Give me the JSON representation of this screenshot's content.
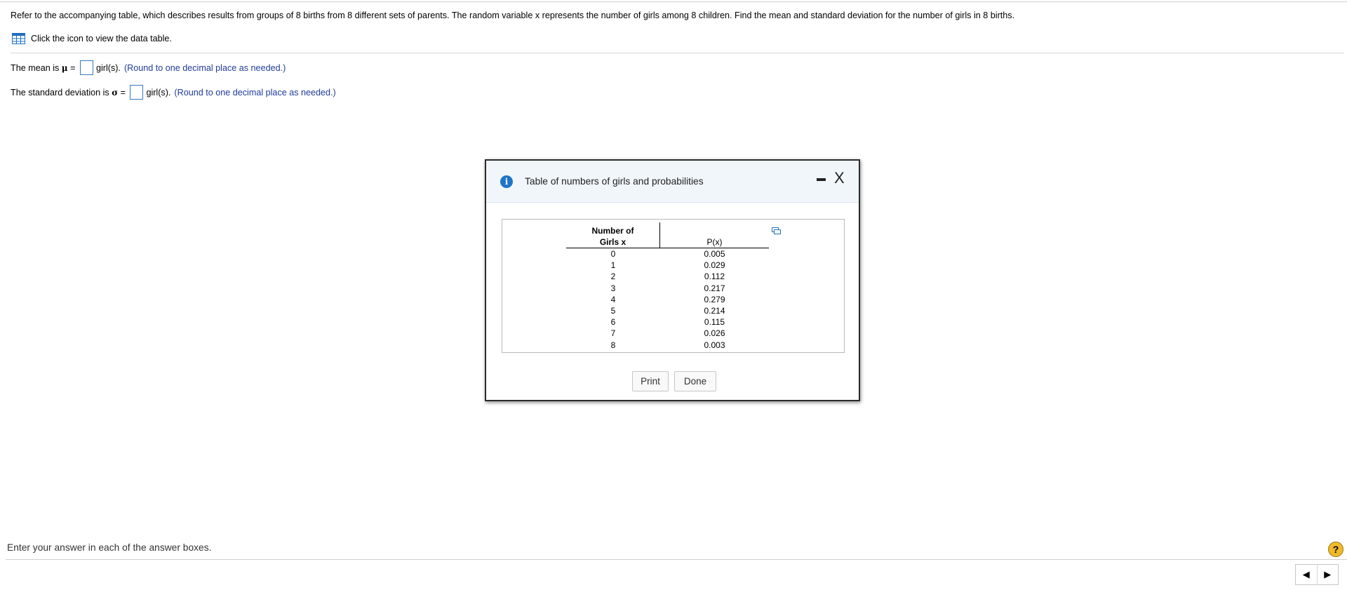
{
  "question": {
    "text": "Refer to the accompanying table, which describes results from groups of 8 births from 8 different sets of parents. The random variable x represents the number of girls among 8 children. Find the mean and standard deviation for the number of girls in 8 births."
  },
  "table_link": {
    "label": "Click the icon to view the data table."
  },
  "answers": {
    "mean": {
      "prefix": "The mean is ",
      "symbol": "μ",
      "equals": " = ",
      "unit": "girl(s).",
      "hint": "(Round to one decimal place as needed.)",
      "value": ""
    },
    "sd": {
      "prefix": "The standard deviation is ",
      "symbol": "σ",
      "equals": " = ",
      "unit": "girl(s).",
      "hint": "(Round to one decimal place as needed.)",
      "value": ""
    }
  },
  "dialog": {
    "title": "Table of numbers of girls and probabilities",
    "info_icon_glyph": "i",
    "close_glyph": "X",
    "table": {
      "col_x_header": [
        "Number of",
        "Girls x"
      ],
      "col_p_header": "P(x)",
      "x": [
        "0",
        "1",
        "2",
        "3",
        "4",
        "5",
        "6",
        "7",
        "8"
      ],
      "p": [
        "0.005",
        "0.029",
        "0.112",
        "0.217",
        "0.279",
        "0.214",
        "0.115",
        "0.026",
        "0.003"
      ]
    },
    "buttons": {
      "print": "Print",
      "done": "Done"
    }
  },
  "footer": {
    "instruction": "Enter your answer in each of the answer boxes.",
    "help_glyph": "?",
    "prev_glyph": "◀",
    "next_glyph": "▶"
  },
  "colors": {
    "accent": "#1e74c9",
    "hint": "#1f3b9a",
    "help": "#f0b928",
    "answer_border": "#3a78c3"
  },
  "icons": [
    "grid-table-icon",
    "info-icon",
    "minimize-icon",
    "close-icon",
    "copy-icon",
    "help-icon",
    "arrow-left-icon",
    "arrow-right-icon"
  ]
}
